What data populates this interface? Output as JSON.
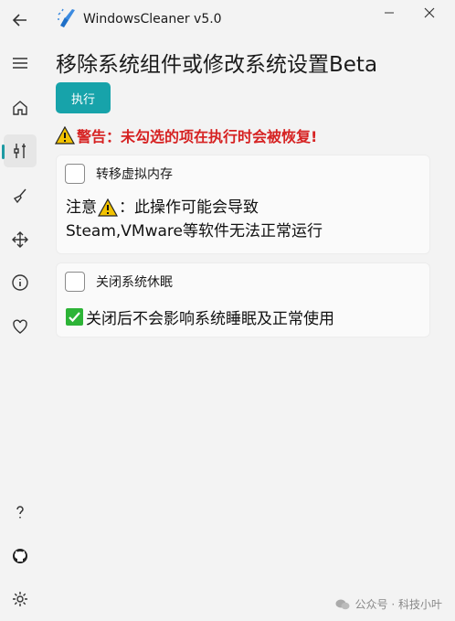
{
  "window": {
    "title": "WindowsCleaner v5.0"
  },
  "sidebar": {
    "items": [
      {
        "icon": "back-arrow-icon",
        "active": false
      },
      {
        "icon": "hamburger-menu-icon",
        "active": false
      },
      {
        "icon": "home-icon",
        "active": false
      },
      {
        "icon": "tools-icon",
        "active": true
      },
      {
        "icon": "broom-icon",
        "active": false
      },
      {
        "icon": "move-arrows-icon",
        "active": false
      },
      {
        "icon": "info-icon",
        "active": false
      },
      {
        "icon": "heart-icon",
        "active": false
      },
      {
        "icon": "help-icon",
        "active": false
      },
      {
        "icon": "github-icon",
        "active": false
      },
      {
        "icon": "settings-gear-icon",
        "active": false
      }
    ]
  },
  "page": {
    "title": "移除系统组件或修改系统设置Beta",
    "run_button": "执行",
    "warning": "警告：未勾选的项在执行时会被恢复!"
  },
  "options": [
    {
      "label": "转移虚拟内存",
      "checked": false,
      "note_prefix": "注意",
      "note_suffix": "：此操作可能会导致",
      "note_line2": "Steam,VMware等软件无法正常运行"
    },
    {
      "label": "关闭系统休眠",
      "checked": false,
      "note": "关闭后不会影响系统睡眠及正常使用"
    }
  ],
  "watermark": "公众号 · 科技小叶",
  "colors": {
    "accent": "#17a3aa",
    "warning": "#d62222",
    "check_green": "#2db437"
  }
}
